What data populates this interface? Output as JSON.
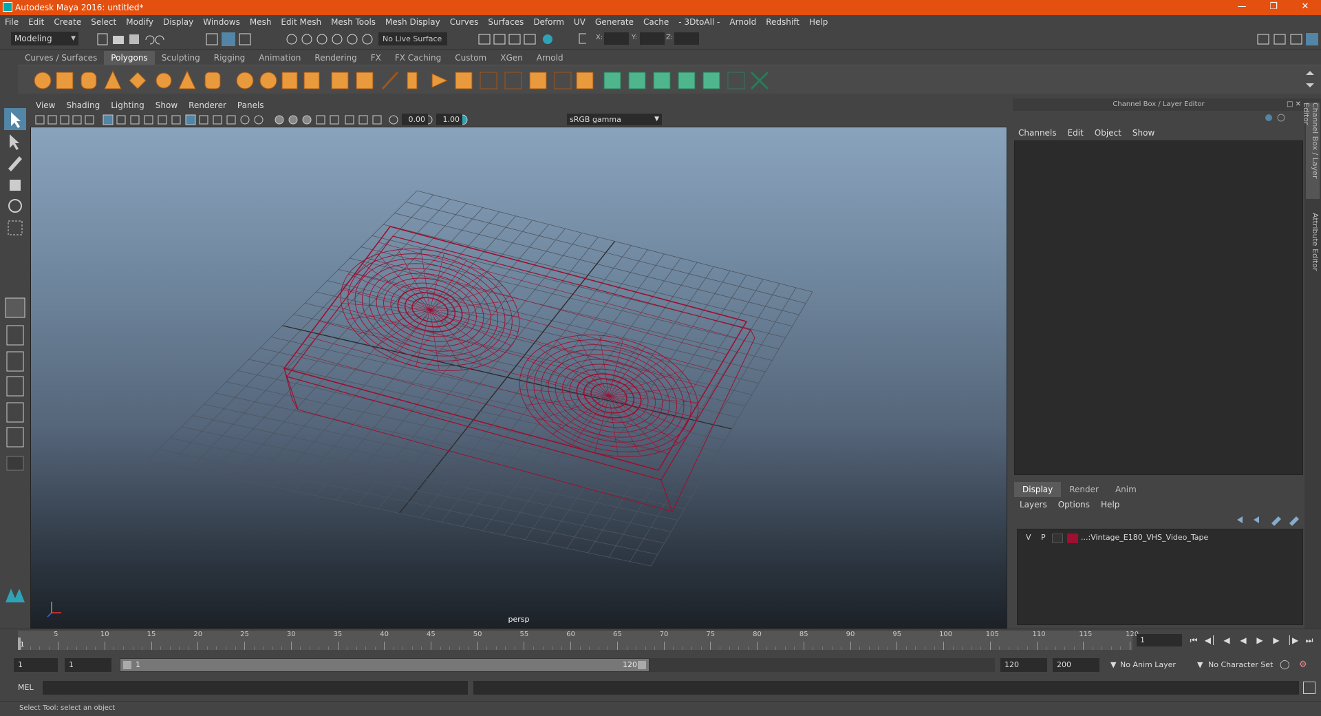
{
  "window": {
    "title": "Autodesk Maya 2016: untitled*"
  },
  "menubar": [
    "File",
    "Edit",
    "Create",
    "Select",
    "Modify",
    "Display",
    "Windows",
    "Mesh",
    "Edit Mesh",
    "Mesh Tools",
    "Mesh Display",
    "Curves",
    "Surfaces",
    "Deform",
    "UV",
    "Generate",
    "Cache",
    "- 3DtoAll -",
    "Arnold",
    "Redshift",
    "Help"
  ],
  "statusline": {
    "mode": "Modeling",
    "live_surface": "No Live Surface",
    "x_label": "X:",
    "y_label": "Y:",
    "z_label": "Z:"
  },
  "shelf_tabs": [
    "Curves / Surfaces",
    "Polygons",
    "Sculpting",
    "Rigging",
    "Animation",
    "Rendering",
    "FX",
    "FX Caching",
    "Custom",
    "XGen",
    "Arnold"
  ],
  "shelf_active": "Polygons",
  "viewport": {
    "menu": [
      "View",
      "Shading",
      "Lighting",
      "Show",
      "Renderer",
      "Panels"
    ],
    "exposure": "0.00",
    "gamma": "1.00",
    "color_space": "sRGB gamma",
    "camera": "persp"
  },
  "channel_box": {
    "header": "Channel Box / Layer Editor",
    "menu": [
      "Channels",
      "Edit",
      "Object",
      "Show"
    ]
  },
  "layer_editor": {
    "tabs": [
      "Display",
      "Render",
      "Anim"
    ],
    "active_tab": "Display",
    "menu": [
      "Layers",
      "Options",
      "Help"
    ],
    "layer": {
      "v": "V",
      "p": "P",
      "name": "...:Vintage_E180_VHS_Video_Tape",
      "color": "#9e0f30"
    }
  },
  "side_tabs": [
    "Channel Box / Layer Editor",
    "Attribute Editor"
  ],
  "timeline": {
    "ticks": [
      "5",
      "10",
      "15",
      "20",
      "25",
      "30",
      "35",
      "40",
      "45",
      "50",
      "55",
      "60",
      "65",
      "70",
      "75",
      "80",
      "85",
      "90",
      "95",
      "100",
      "105",
      "110",
      "115",
      "120"
    ],
    "start_label": "1",
    "current_frame": "1"
  },
  "range": {
    "start": "1",
    "playback_start": "1",
    "bar_start": "1",
    "bar_end": "120",
    "playback_end": "120",
    "end": "200",
    "anim_layer": "No Anim Layer",
    "character_set": "No Character Set"
  },
  "command": {
    "label": "MEL"
  },
  "help": {
    "text": "Select Tool: select an object"
  },
  "colors": {
    "title_bar": "#e4500f",
    "wire": "#9e0f30",
    "accent": "#5285a6"
  }
}
